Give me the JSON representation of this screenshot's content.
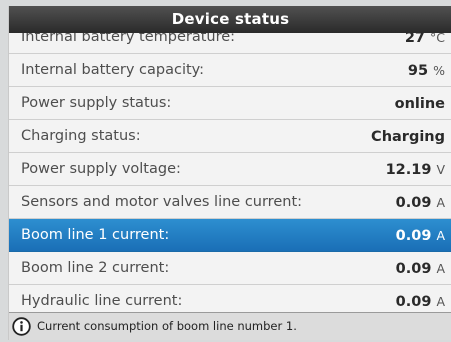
{
  "header": {
    "title": "Device status"
  },
  "rows": [
    {
      "label": "Internal battery temperature:",
      "value": "27",
      "unit": "°C",
      "selected": false
    },
    {
      "label": "Internal battery capacity:",
      "value": "95",
      "unit": "%",
      "selected": false
    },
    {
      "label": "Power supply status:",
      "value": "online",
      "unit": "",
      "selected": false
    },
    {
      "label": "Charging status:",
      "value": "Charging",
      "unit": "",
      "selected": false
    },
    {
      "label": "Power supply voltage:",
      "value": "12.19",
      "unit": "V",
      "selected": false
    },
    {
      "label": "Sensors and motor valves line current:",
      "value": "0.09",
      "unit": "A",
      "selected": false
    },
    {
      "label": "Boom line 1 current:",
      "value": "0.09",
      "unit": "A",
      "selected": true
    },
    {
      "label": "Boom line 2 current:",
      "value": "0.09",
      "unit": "A",
      "selected": false
    },
    {
      "label": "Hydraulic line current:",
      "value": "0.09",
      "unit": "A",
      "selected": false
    }
  ],
  "status_bar": {
    "icon": "info-icon",
    "text": "Current consumption of boom line number 1."
  },
  "colors": {
    "header_bg": "#2a2a2a",
    "selected_row": "#1f7fc4",
    "row_bg": "#f3f3f3",
    "status_bar_bg": "#dcdcdc"
  }
}
